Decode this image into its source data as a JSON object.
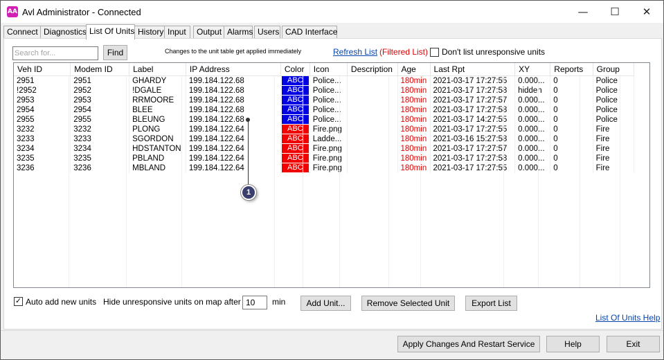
{
  "window": {
    "icon_text": "AA",
    "title": "Avl Administrator - Connected",
    "minimize": "—",
    "maximize": "☐",
    "close": "✕"
  },
  "tabs": [
    {
      "label": "Connect"
    },
    {
      "label": "Diagnostics"
    },
    {
      "label": "List Of Units",
      "active": true
    },
    {
      "label": "History"
    },
    {
      "label": "Input"
    },
    {
      "label": "Output"
    },
    {
      "label": "Alarms"
    },
    {
      "label": "Users"
    },
    {
      "label": "CAD Interface"
    }
  ],
  "toolbar": {
    "search_placeholder": "Search for...",
    "find_label": "Find",
    "notice": "Changes to the unit table get applied immediately",
    "refresh_label": "Refresh List",
    "filtered_label": "(Filtered List)",
    "dont_list_label": "Don't list unresponsive units",
    "dont_list_checked": false
  },
  "table": {
    "columns": [
      "Veh ID",
      "Modem ID",
      "Label",
      "IP Address",
      "Color",
      "Icon",
      "Description",
      "Age",
      "Last Rpt",
      "XY",
      "Reports",
      "Group"
    ],
    "rows": [
      {
        "veh": "2951",
        "modem": "2951",
        "label": "GHARDY",
        "ip": "199.184.122.68",
        "color": "ABC",
        "color_hex": "#0000e0",
        "icon": "Police...",
        "desc": "",
        "age": "180min",
        "last": "2021-03-17 17:27:55",
        "xy": "0.000...",
        "reports": "0",
        "group": "Police"
      },
      {
        "veh": "!2952",
        "modem": "2952",
        "label": "!DGALE",
        "ip": "199.184.122.68",
        "color": "ABC",
        "color_hex": "#0000e0",
        "icon": "Police...",
        "desc": "",
        "age": "180min",
        "last": "2021-03-17 17:27:58",
        "xy": "hidden",
        "reports": "0",
        "group": "Police"
      },
      {
        "veh": "2953",
        "modem": "2953",
        "label": "RRMOORE",
        "ip": "199.184.122.68",
        "color": "ABC",
        "color_hex": "#0000e0",
        "icon": "Police...",
        "desc": "",
        "age": "180min",
        "last": "2021-03-17 17:27:57",
        "xy": "0.000...",
        "reports": "0",
        "group": "Police"
      },
      {
        "veh": "2954",
        "modem": "2954",
        "label": "BLEE",
        "ip": "199.184.122.68",
        "color": "ABC",
        "color_hex": "#0000e0",
        "icon": "Police...",
        "desc": "",
        "age": "180min",
        "last": "2021-03-17 17:27:58",
        "xy": "0.000...",
        "reports": "0",
        "group": "Police"
      },
      {
        "veh": "2955",
        "modem": "2955",
        "label": "BLEUNG",
        "ip": "199.184.122.68",
        "color": "ABC",
        "color_hex": "#0000e0",
        "icon": "Police...",
        "desc": "",
        "age": "180min",
        "last": "2021-03-17 14:27:55",
        "xy": "0.000...",
        "reports": "0",
        "group": "Police"
      },
      {
        "veh": "3232",
        "modem": "3232",
        "label": "PLONG",
        "ip": "199.184.122.64",
        "color": "ABC",
        "color_hex": "#f00000",
        "icon": "Fire.png",
        "desc": "",
        "age": "180min",
        "last": "2021-03-17 17:27:55",
        "xy": "0.000...",
        "reports": "0",
        "group": "Fire"
      },
      {
        "veh": "3233",
        "modem": "3233",
        "label": "SGORDON",
        "ip": "199.184.122.64",
        "color": "ABC",
        "color_hex": "#f00000",
        "icon": "Ladde...",
        "desc": "",
        "age": "180min",
        "last": "2021-03-16 15:27:58",
        "xy": "0.000...",
        "reports": "0",
        "group": "Fire"
      },
      {
        "veh": "3234",
        "modem": "3234",
        "label": "HDSTANTON",
        "ip": "199.184.122.64",
        "color": "ABC",
        "color_hex": "#f00000",
        "icon": "Fire.png",
        "desc": "",
        "age": "180min",
        "last": "2021-03-17 17:27:57",
        "xy": "0.000...",
        "reports": "0",
        "group": "Fire"
      },
      {
        "veh": "3235",
        "modem": "3235",
        "label": "PBLAND",
        "ip": "199.184.122.64",
        "color": "ABC",
        "color_hex": "#f00000",
        "icon": "Fire.png",
        "desc": "",
        "age": "180min",
        "last": "2021-03-17 17:27:58",
        "xy": "0.000...",
        "reports": "0",
        "group": "Fire"
      },
      {
        "veh": "3236",
        "modem": "3236",
        "label": "MBLAND",
        "ip": "199.184.122.64",
        "color": "ABC",
        "color_hex": "#f00000",
        "icon": "Fire.png",
        "desc": "",
        "age": "180min",
        "last": "2021-03-17 17:27:55",
        "xy": "0.000...",
        "reports": "0",
        "group": "Fire"
      }
    ]
  },
  "callout": {
    "number": "1"
  },
  "bottom": {
    "auto_add_checked": true,
    "auto_add_label": "Auto add new units",
    "hide_label": "Hide unresponsive units on map after",
    "minutes_value": "10",
    "min_label": "min",
    "add_unit_label": "Add Unit...",
    "remove_label": "Remove Selected Unit",
    "export_label": "Export List",
    "help_link": "List Of Units Help"
  },
  "footer": {
    "apply_label": "Apply Changes And Restart Service",
    "help_label": "Help",
    "exit_label": "Exit"
  },
  "colors": {
    "police_blue": "#0000e0",
    "fire_red": "#f00000",
    "age_red": "#e00000",
    "link_blue": "#0645ad"
  }
}
